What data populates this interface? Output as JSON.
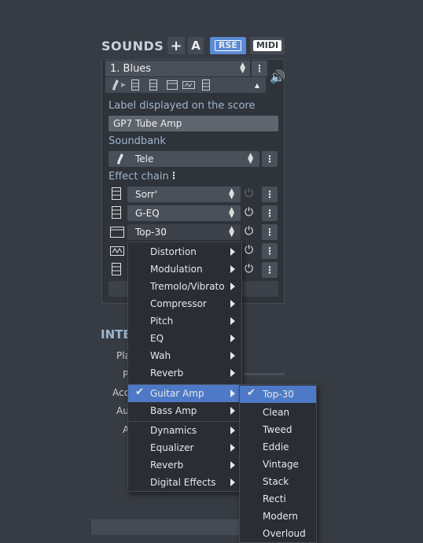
{
  "sounds": {
    "title": "SOUNDS",
    "add_label": "+",
    "a_label": "A",
    "rse_label": "RSE",
    "midi_label": "MIDI"
  },
  "track": {
    "name": "1. Blues"
  },
  "label_section": {
    "title": "Label displayed on the score",
    "value": "GP7 Tube Amp"
  },
  "soundbank": {
    "title": "Soundbank",
    "value": "Tele"
  },
  "effect_chain": {
    "title": "Effect chain",
    "items": [
      {
        "name": "Sorr'"
      },
      {
        "name": "G-EQ"
      },
      {
        "name": "Top-30"
      }
    ]
  },
  "background": {
    "section_title_partial": "INTE",
    "label_partial_1": "Pla",
    "label_partial_2": "P",
    "label_partial_3": "Acc",
    "label_partial_4": "Au",
    "label_partial_5": "A"
  },
  "context_menu": {
    "items": [
      "Distortion",
      "Modulation",
      "Tremolo/Vibrato",
      "Compressor",
      "Pitch",
      "EQ",
      "Wah",
      "Reverb"
    ],
    "amp_items": [
      "Guitar Amp",
      "Bass Amp"
    ],
    "effect_items": [
      "Dynamics",
      "Equalizer",
      "Reverb",
      "Digital Effects"
    ],
    "selected": "Guitar Amp"
  },
  "submenu": {
    "items": [
      "Top-30",
      "Clean",
      "Tweed",
      "Eddie",
      "Vintage",
      "Stack",
      "Recti",
      "Modern",
      "Overloud"
    ],
    "selected": "Top-30"
  },
  "colors": {
    "accent": "#4e79c6",
    "background": "#373b43"
  }
}
